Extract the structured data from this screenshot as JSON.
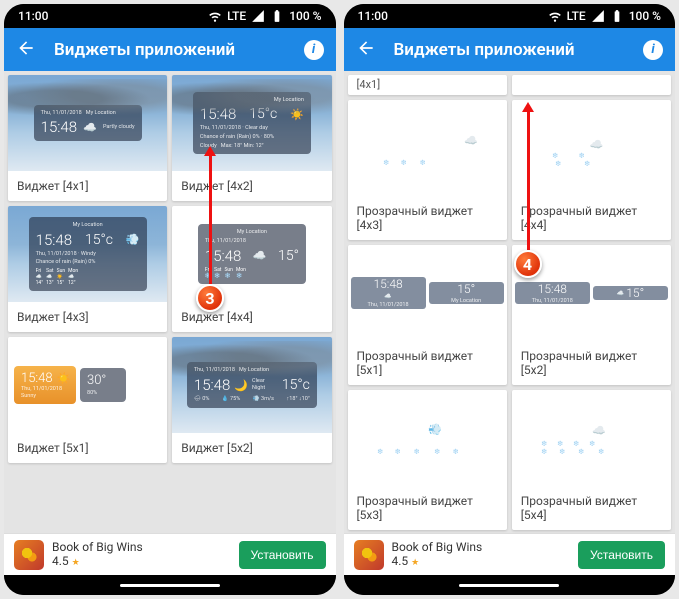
{
  "status": {
    "time": "11:00",
    "network": "LTE",
    "battery": "100 %"
  },
  "appbar": {
    "title": "Виджеты приложений"
  },
  "widget": {
    "location": "My Location",
    "date": "Thu, 11/01/2018",
    "time": "15:48",
    "temp": "15°",
    "temp_c": "15°c",
    "cond_partly": "Partly cloudy",
    "cond_clear": "Clear day",
    "cond_cloudy": "Cloudy",
    "cond_windy": "Windy",
    "cond_night": "Clear Night",
    "cond_sunny": "Sunny",
    "humidity": "80%",
    "max": "Max: 18°",
    "min": "Min: 12°",
    "chance": "Chance of rain (Rain) 0%",
    "sun_temp": "30°"
  },
  "labels_left": {
    "w41": "Виджет [4x1]",
    "w42": "Виджет [4x2]",
    "w43": "Виджет [4x3]",
    "w44": "Виджет [4x4]",
    "w51": "Виджет [5x1]",
    "w52": "Виджет [5x2]"
  },
  "labels_right": {
    "top_stub": "[4x1]",
    "t43": "Прозрачный виджет [4x3]",
    "t44": "Прозрачный виджет [4x4]",
    "t51": "Прозрачный виджет [5x1]",
    "t52": "Прозрачный виджет [5x2]",
    "t53": "Прозрачный виджет [5x3]",
    "t54": "Прозрачный виджет [5x4]"
  },
  "ad": {
    "title": "Book of Big Wins",
    "rating": "4.5",
    "button": "Установить"
  },
  "badges": {
    "b3": "3",
    "b4": "4"
  }
}
